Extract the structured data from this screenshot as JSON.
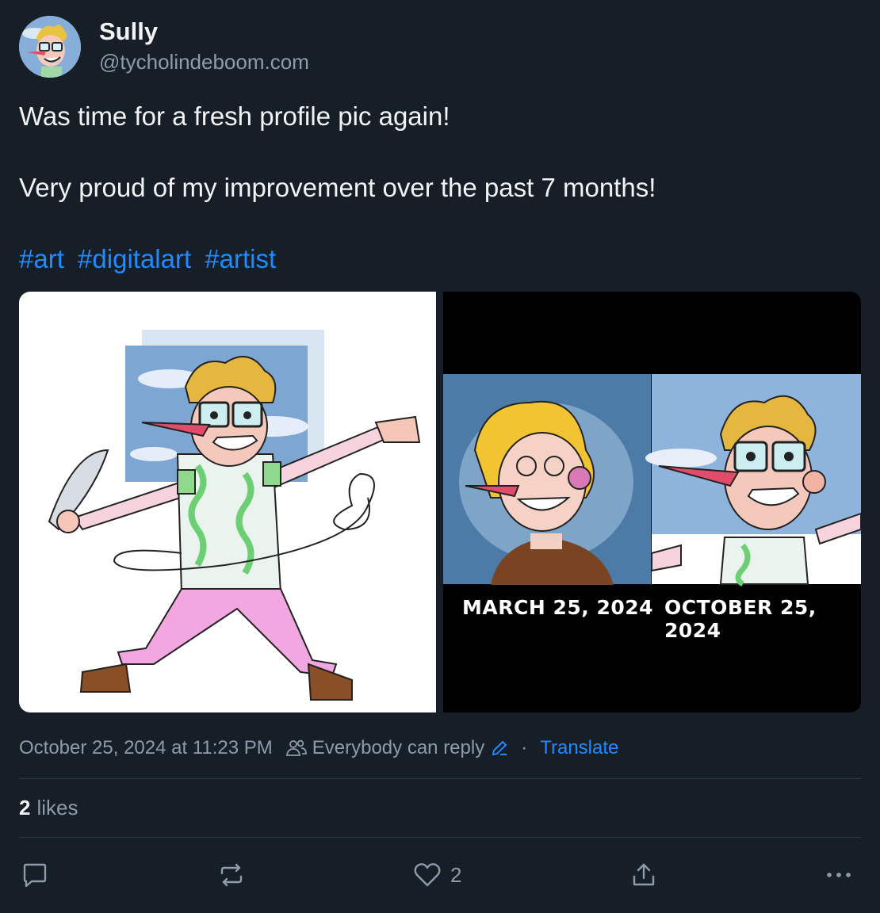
{
  "author": {
    "display_name": "Sully",
    "handle": "@tycholindeboom.com"
  },
  "post": {
    "lines": [
      "Was time for a fresh profile pic again!",
      "Very proud of my improvement over the past 7 months!"
    ],
    "hashtags": [
      "#art",
      "#digitalart",
      "#artist"
    ]
  },
  "images": {
    "right": {
      "caption_left": "MARCH 25, 2024",
      "caption_right": "OCTOBER 25, 2024"
    }
  },
  "meta": {
    "timestamp": "October 25, 2024 at 11:23 PM",
    "reply_setting": "Everybody can reply",
    "separator": "·",
    "translate": "Translate"
  },
  "stats": {
    "likes_count": "2",
    "likes_label": "likes"
  },
  "actions": {
    "like_count": "2"
  },
  "colors": {
    "background": "#161e27",
    "link": "#208bfe",
    "muted": "#8f9bab"
  }
}
